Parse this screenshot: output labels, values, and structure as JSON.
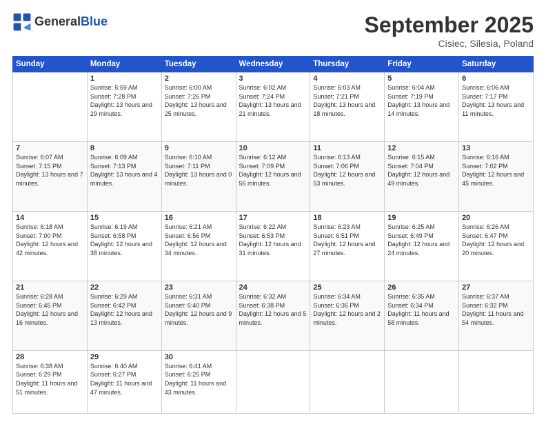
{
  "header": {
    "logo_general": "General",
    "logo_blue": "Blue",
    "month": "September 2025",
    "location": "Cisiec, Silesia, Poland"
  },
  "weekdays": [
    "Sunday",
    "Monday",
    "Tuesday",
    "Wednesday",
    "Thursday",
    "Friday",
    "Saturday"
  ],
  "weeks": [
    [
      {
        "day": null
      },
      {
        "day": "1",
        "sunrise": "5:59 AM",
        "sunset": "7:28 PM",
        "daylight": "13 hours and 29 minutes."
      },
      {
        "day": "2",
        "sunrise": "6:00 AM",
        "sunset": "7:26 PM",
        "daylight": "13 hours and 25 minutes."
      },
      {
        "day": "3",
        "sunrise": "6:02 AM",
        "sunset": "7:24 PM",
        "daylight": "13 hours and 21 minutes."
      },
      {
        "day": "4",
        "sunrise": "6:03 AM",
        "sunset": "7:21 PM",
        "daylight": "13 hours and 18 minutes."
      },
      {
        "day": "5",
        "sunrise": "6:04 AM",
        "sunset": "7:19 PM",
        "daylight": "13 hours and 14 minutes."
      },
      {
        "day": "6",
        "sunrise": "6:06 AM",
        "sunset": "7:17 PM",
        "daylight": "13 hours and 11 minutes."
      }
    ],
    [
      {
        "day": "7",
        "sunrise": "6:07 AM",
        "sunset": "7:15 PM",
        "daylight": "13 hours and 7 minutes."
      },
      {
        "day": "8",
        "sunrise": "6:09 AM",
        "sunset": "7:13 PM",
        "daylight": "13 hours and 4 minutes."
      },
      {
        "day": "9",
        "sunrise": "6:10 AM",
        "sunset": "7:11 PM",
        "daylight": "13 hours and 0 minutes."
      },
      {
        "day": "10",
        "sunrise": "6:12 AM",
        "sunset": "7:09 PM",
        "daylight": "12 hours and 56 minutes."
      },
      {
        "day": "11",
        "sunrise": "6:13 AM",
        "sunset": "7:06 PM",
        "daylight": "12 hours and 53 minutes."
      },
      {
        "day": "12",
        "sunrise": "6:15 AM",
        "sunset": "7:04 PM",
        "daylight": "12 hours and 49 minutes."
      },
      {
        "day": "13",
        "sunrise": "6:16 AM",
        "sunset": "7:02 PM",
        "daylight": "12 hours and 45 minutes."
      }
    ],
    [
      {
        "day": "14",
        "sunrise": "6:18 AM",
        "sunset": "7:00 PM",
        "daylight": "12 hours and 42 minutes."
      },
      {
        "day": "15",
        "sunrise": "6:19 AM",
        "sunset": "6:58 PM",
        "daylight": "12 hours and 38 minutes."
      },
      {
        "day": "16",
        "sunrise": "6:21 AM",
        "sunset": "6:56 PM",
        "daylight": "12 hours and 34 minutes."
      },
      {
        "day": "17",
        "sunrise": "6:22 AM",
        "sunset": "6:53 PM",
        "daylight": "12 hours and 31 minutes."
      },
      {
        "day": "18",
        "sunrise": "6:23 AM",
        "sunset": "6:51 PM",
        "daylight": "12 hours and 27 minutes."
      },
      {
        "day": "19",
        "sunrise": "6:25 AM",
        "sunset": "6:49 PM",
        "daylight": "12 hours and 24 minutes."
      },
      {
        "day": "20",
        "sunrise": "6:26 AM",
        "sunset": "6:47 PM",
        "daylight": "12 hours and 20 minutes."
      }
    ],
    [
      {
        "day": "21",
        "sunrise": "6:28 AM",
        "sunset": "6:45 PM",
        "daylight": "12 hours and 16 minutes."
      },
      {
        "day": "22",
        "sunrise": "6:29 AM",
        "sunset": "6:42 PM",
        "daylight": "12 hours and 13 minutes."
      },
      {
        "day": "23",
        "sunrise": "6:31 AM",
        "sunset": "6:40 PM",
        "daylight": "12 hours and 9 minutes."
      },
      {
        "day": "24",
        "sunrise": "6:32 AM",
        "sunset": "6:38 PM",
        "daylight": "12 hours and 5 minutes."
      },
      {
        "day": "25",
        "sunrise": "6:34 AM",
        "sunset": "6:36 PM",
        "daylight": "12 hours and 2 minutes."
      },
      {
        "day": "26",
        "sunrise": "6:35 AM",
        "sunset": "6:34 PM",
        "daylight": "11 hours and 58 minutes."
      },
      {
        "day": "27",
        "sunrise": "6:37 AM",
        "sunset": "6:32 PM",
        "daylight": "11 hours and 54 minutes."
      }
    ],
    [
      {
        "day": "28",
        "sunrise": "6:38 AM",
        "sunset": "6:29 PM",
        "daylight": "11 hours and 51 minutes."
      },
      {
        "day": "29",
        "sunrise": "6:40 AM",
        "sunset": "6:27 PM",
        "daylight": "11 hours and 47 minutes."
      },
      {
        "day": "30",
        "sunrise": "6:41 AM",
        "sunset": "6:25 PM",
        "daylight": "11 hours and 43 minutes."
      },
      {
        "day": null
      },
      {
        "day": null
      },
      {
        "day": null
      },
      {
        "day": null
      }
    ]
  ]
}
